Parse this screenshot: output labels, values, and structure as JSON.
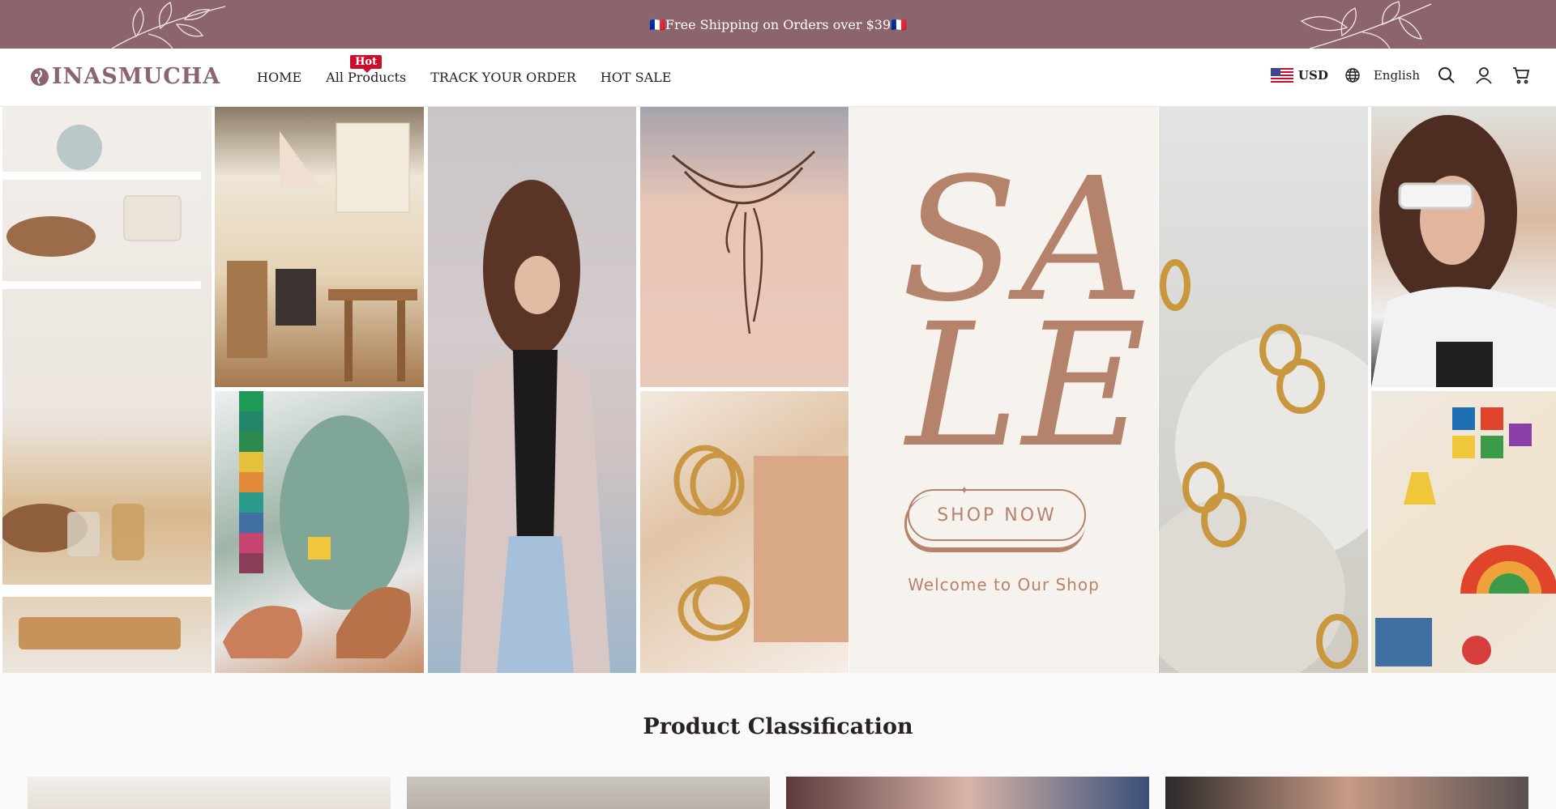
{
  "announcement": {
    "text": "🇫🇷Free Shipping on Orders over $39🇫🇷"
  },
  "header": {
    "logo": "INASMUCHA",
    "nav": [
      {
        "label": "HOME"
      },
      {
        "label": "All Products",
        "badge": "Hot"
      },
      {
        "label": "TRACK YOUR ORDER"
      },
      {
        "label": "HOT SALE"
      }
    ],
    "currency": "USD",
    "language": "English",
    "icons": [
      "globe-icon",
      "search-icon",
      "account-icon",
      "cart-icon"
    ]
  },
  "hero": {
    "sale_line1": "SA",
    "sale_line2": "LE",
    "cta": "SHOP NOW",
    "welcome": "Welcome to Our Shop"
  },
  "section": {
    "title": "Product Classification"
  },
  "colors": {
    "brand": "#8c646b",
    "sale_accent": "#b5826c",
    "hot_badge": "#c8102e"
  }
}
